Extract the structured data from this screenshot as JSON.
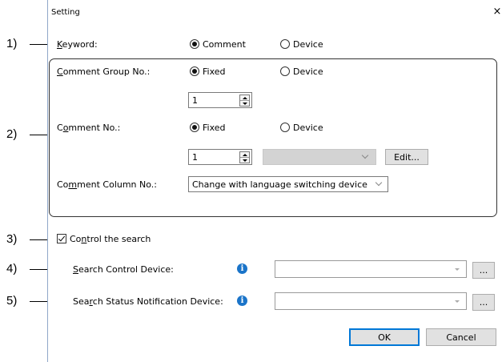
{
  "dialog": {
    "title": "Setting",
    "close_label": "×"
  },
  "keyword": {
    "label_pre": "",
    "label_u": "K",
    "label_post": "eyword:",
    "opt_comment": "Comment",
    "opt_device": "Device"
  },
  "group": {
    "comment_group_no": {
      "label_pre": "",
      "label_u": "C",
      "label_post": "omment Group No.:",
      "opt_fixed": "Fixed",
      "opt_device": "Device",
      "value": "1"
    },
    "comment_no": {
      "label_pre": "C",
      "label_u": "o",
      "label_post": "mment No.:",
      "opt_fixed": "Fixed",
      "opt_device": "Device",
      "value": "1",
      "edit_label": "Edit..."
    },
    "comment_column_no": {
      "label_pre": "Co",
      "label_u": "m",
      "label_post": "ment Column No.:",
      "selected": "Change with language switching device"
    }
  },
  "control_search": {
    "label_pre": "Co",
    "label_u": "n",
    "label_post": "trol the search",
    "checked": true
  },
  "search_control_device": {
    "label_pre": "",
    "label_u": "S",
    "label_post": "earch Control Device:",
    "browse_label": "...",
    "value": ""
  },
  "search_status_device": {
    "label_pre": "Sea",
    "label_u": "r",
    "label_post": "ch Status Notification Device:",
    "browse_label": "...",
    "value": ""
  },
  "buttons": {
    "ok": "OK",
    "cancel": "Cancel"
  },
  "callouts": [
    "1)",
    "2)",
    "3)",
    "4)",
    "5)"
  ],
  "colors": {
    "accent": "#0078d7",
    "info": "#1a74c9",
    "disabled": "#d3d3d3"
  }
}
